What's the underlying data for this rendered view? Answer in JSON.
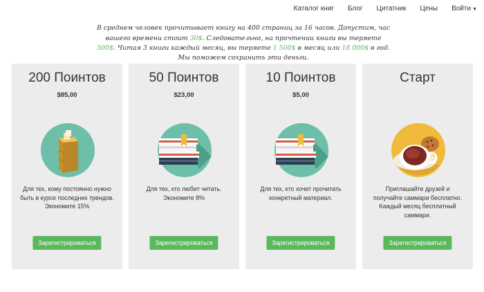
{
  "nav": {
    "items": [
      "Каталог книг",
      "Блог",
      "Цитатник",
      "Цены",
      "Войти"
    ]
  },
  "intro": {
    "p1": "В среднем человек прочитывает книгу на 400 страниц за 16 часов. Допустим, час вашего времени стоит ",
    "v1": "30$",
    "p2": ". Следовательно, на прочтении книги вы теряете ",
    "v2": "500$",
    "p3": ". Читая 3 книги каждый месяц, вы теряете ",
    "v3": "1 500$",
    "p4": " в месяц или ",
    "v4": "18 000$",
    "p5": " в год. Мы поможем сохранить эти деньги."
  },
  "cards": [
    {
      "title": "200 Поинтов",
      "price": "$85,00",
      "icon": "box-icon",
      "desc": "Для тех, кому постоянно нужно быть в курсе последних трендов. Экономите 15%",
      "button": "Зарегистрироваться"
    },
    {
      "title": "50 Поинтов",
      "price": "$23,00",
      "icon": "books-icon",
      "desc": "Для тех, кто любит читать. Экономите 8%",
      "button": "Зарегистрироваться"
    },
    {
      "title": "10 Поинтов",
      "price": "$5,00",
      "icon": "books-icon",
      "desc": "Для тех, кто хочет прочитать конкретный материал.",
      "button": "Зарегистрироваться"
    },
    {
      "title": "Старт",
      "price": "",
      "icon": "coffee-icon",
      "desc": "Приглашайте друзей и получайте саммари бесплатно. Каждый месяц бесплатный саммари.",
      "button": "Зарегистрироваться"
    }
  ],
  "colors": {
    "accent": "#5bb65a",
    "button": "#5cb85c",
    "card_bg": "#ececec",
    "teal": "#6dbfa9",
    "yellow": "#f0bb3c"
  }
}
